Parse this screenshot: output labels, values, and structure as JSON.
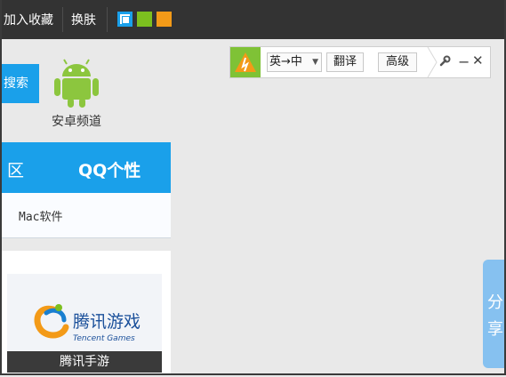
{
  "topbar": {
    "add_favorite": "加入收藏",
    "change_skin": "换肤",
    "skin_colors": [
      "#1aa0ea",
      "#7cbf1f",
      "#f39a18"
    ]
  },
  "left": {
    "search_label": "搜索",
    "android_label": "安卓频道",
    "tabs": {
      "tab1": "区",
      "tab2": "QQ个性"
    },
    "mac_link": "Mac软件",
    "game_brand": "腾讯游戏",
    "game_brand_en": "Tencent Games",
    "game_caption": "腾讯手游"
  },
  "translate_bar": {
    "lang_pair": "英→中",
    "translate_btn": "翻译",
    "advanced_btn": "高级",
    "accent": "#7fc236"
  },
  "share": {
    "chars": [
      "分",
      "享"
    ],
    "color": "#86c1f0"
  }
}
